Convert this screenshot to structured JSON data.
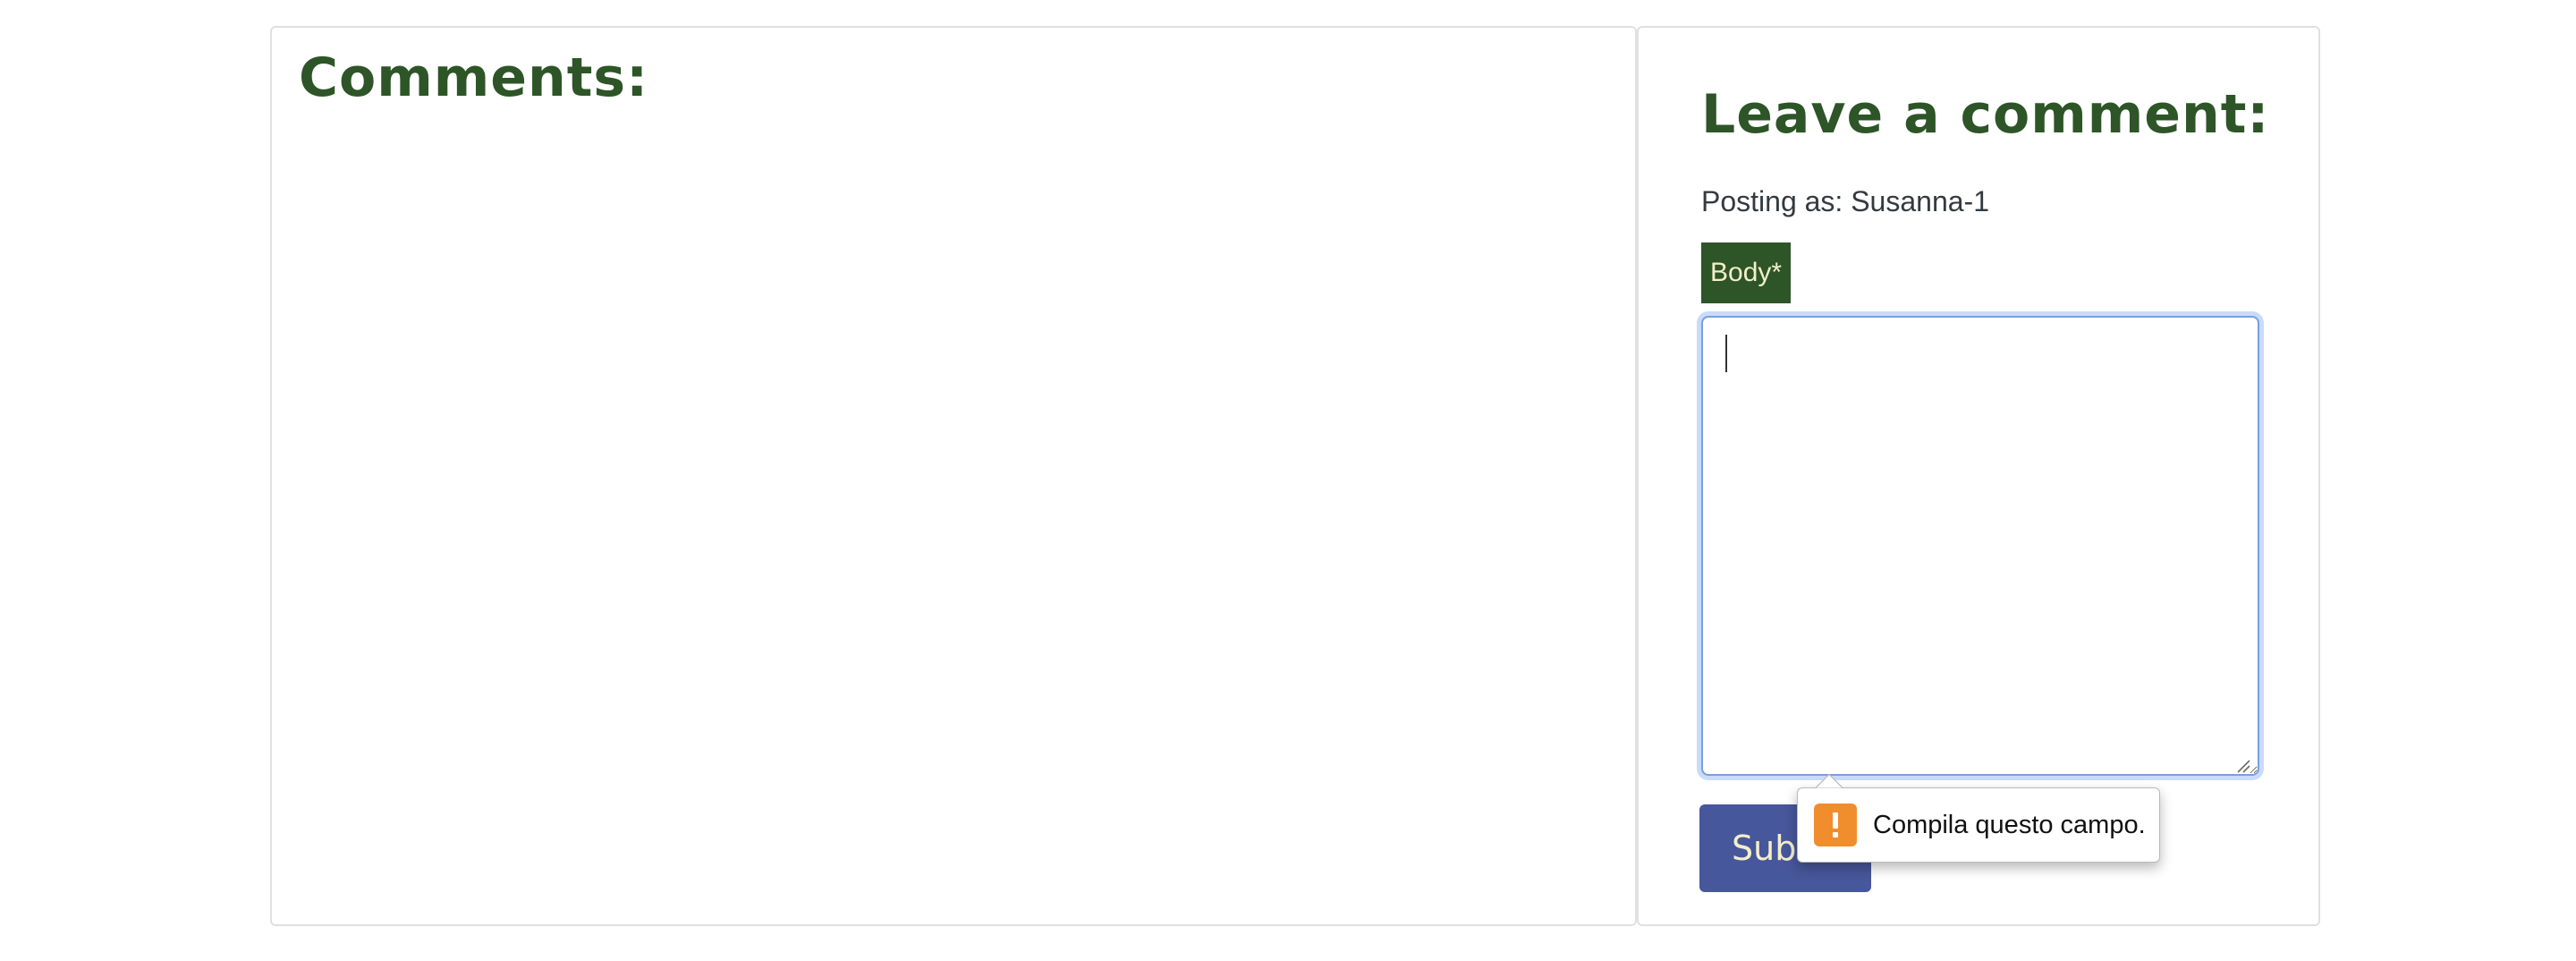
{
  "comments_panel": {
    "heading": "Comments:"
  },
  "comment_form": {
    "heading": "Leave a comment:",
    "posting_as": "Posting as: Susanna-1",
    "body_label": "Body*",
    "body_value": "",
    "submit_label": "Submit"
  },
  "validation_tooltip": {
    "message": "Compila questo campo.",
    "icon": "warning-icon"
  },
  "colors": {
    "heading_green": "#2d5527",
    "label_bg": "#2d5527",
    "label_text": "#f3efc9",
    "submit_bg": "#47579b",
    "warning_orange": "#f08d2d",
    "focus_ring": "#9dbdf5"
  }
}
